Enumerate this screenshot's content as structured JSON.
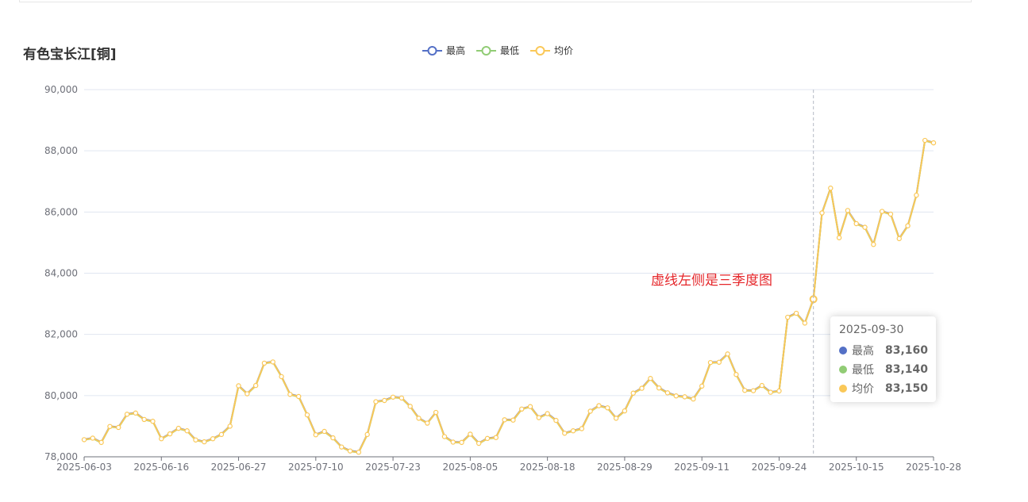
{
  "title": "有色宝长江[铜]",
  "annotation": "虚线左侧是三季度图",
  "legend": [
    {
      "name": "最高",
      "color": "#5470c6"
    },
    {
      "name": "最低",
      "color": "#91cc75"
    },
    {
      "name": "均价",
      "color": "#fac858"
    }
  ],
  "tooltip": {
    "date": "2025-09-30",
    "rows": [
      {
        "name": "最高",
        "value": "83,160",
        "color": "#5470c6"
      },
      {
        "name": "最低",
        "value": "83,140",
        "color": "#91cc75"
      },
      {
        "name": "均价",
        "value": "83,150",
        "color": "#fac858"
      }
    ]
  },
  "chart_data": {
    "type": "line",
    "title": "有色宝长江[铜]",
    "ylim": [
      78000,
      90000
    ],
    "y_ticks": [
      "78,000",
      "80,000",
      "82,000",
      "84,000",
      "86,000",
      "88,000",
      "90,000"
    ],
    "x_ticks": [
      "2025-06-03",
      "2025-06-16",
      "2025-06-27",
      "2025-07-10",
      "2025-07-23",
      "2025-08-05",
      "2025-08-18",
      "2025-08-29",
      "2025-09-11",
      "2025-09-24",
      "2025-10-15",
      "2025-10-28"
    ],
    "grid": true,
    "legend_position": "top-center",
    "highlight_date": "2025-09-30",
    "dates": [
      "2025-06-03",
      "2025-06-04",
      "2025-06-05",
      "2025-06-06",
      "2025-06-09",
      "2025-06-10",
      "2025-06-11",
      "2025-06-12",
      "2025-06-13",
      "2025-06-16",
      "2025-06-17",
      "2025-06-18",
      "2025-06-19",
      "2025-06-20",
      "2025-06-23",
      "2025-06-24",
      "2025-06-25",
      "2025-06-26",
      "2025-06-27",
      "2025-06-30",
      "2025-07-01",
      "2025-07-02",
      "2025-07-03",
      "2025-07-04",
      "2025-07-07",
      "2025-07-08",
      "2025-07-09",
      "2025-07-10",
      "2025-07-11",
      "2025-07-14",
      "2025-07-15",
      "2025-07-16",
      "2025-07-17",
      "2025-07-18",
      "2025-07-21",
      "2025-07-22",
      "2025-07-23",
      "2025-07-24",
      "2025-07-25",
      "2025-07-28",
      "2025-07-29",
      "2025-07-30",
      "2025-07-31",
      "2025-08-01",
      "2025-08-04",
      "2025-08-05",
      "2025-08-06",
      "2025-08-07",
      "2025-08-08",
      "2025-08-11",
      "2025-08-12",
      "2025-08-13",
      "2025-08-14",
      "2025-08-15",
      "2025-08-18",
      "2025-08-19",
      "2025-08-20",
      "2025-08-21",
      "2025-08-22",
      "2025-08-25",
      "2025-08-26",
      "2025-08-27",
      "2025-08-28",
      "2025-08-29",
      "2025-09-01",
      "2025-09-02",
      "2025-09-03",
      "2025-09-04",
      "2025-09-05",
      "2025-09-08",
      "2025-09-09",
      "2025-09-10",
      "2025-09-11",
      "2025-09-12",
      "2025-09-15",
      "2025-09-16",
      "2025-09-17",
      "2025-09-18",
      "2025-09-19",
      "2025-09-22",
      "2025-09-23",
      "2025-09-24",
      "2025-09-25",
      "2025-09-26",
      "2025-09-29",
      "2025-09-30",
      "2025-10-09",
      "2025-10-10",
      "2025-10-13",
      "2025-10-14",
      "2025-10-15",
      "2025-10-16",
      "2025-10-17",
      "2025-10-20",
      "2025-10-21",
      "2025-10-22",
      "2025-10-23",
      "2025-10-24",
      "2025-10-27",
      "2025-10-28"
    ],
    "series": [
      {
        "name": "最高",
        "values": [
          78570,
          78620,
          78480,
          79000,
          78970,
          79400,
          79440,
          79230,
          79170,
          78600,
          78760,
          78940,
          78860,
          78560,
          78500,
          78600,
          78740,
          79010,
          80330,
          80070,
          80340,
          81070,
          81110,
          80630,
          80050,
          79980,
          79380,
          78730,
          78840,
          78630,
          78330,
          78200,
          78160,
          78740,
          79810,
          79850,
          79960,
          79930,
          79660,
          79270,
          79110,
          79460,
          78670,
          78490,
          78480,
          78750,
          78450,
          78610,
          78640,
          79220,
          79210,
          79570,
          79650,
          79290,
          79420,
          79200,
          78780,
          78860,
          78930,
          79500,
          79680,
          79610,
          79270,
          79510,
          80090,
          80250,
          80570,
          80260,
          80100,
          80000,
          79970,
          79900,
          80320,
          81090,
          81100,
          81370,
          80700,
          80180,
          80170,
          80340,
          80120,
          80160,
          82570,
          82700,
          82380,
          83160,
          85980,
          86790,
          85170,
          86060,
          85630,
          85510,
          84950,
          86030,
          85940,
          85140,
          85560,
          86560,
          88350,
          88270
        ]
      },
      {
        "name": "最低",
        "values": [
          78550,
          78600,
          78460,
          78980,
          78950,
          79380,
          79420,
          79210,
          79150,
          78580,
          78740,
          78920,
          78840,
          78540,
          78480,
          78580,
          78720,
          78990,
          80310,
          80050,
          80320,
          81050,
          81090,
          80610,
          80030,
          79960,
          79360,
          78710,
          78820,
          78610,
          78310,
          78180,
          78140,
          78720,
          79790,
          79830,
          79940,
          79910,
          79640,
          79250,
          79090,
          79440,
          78650,
          78470,
          78460,
          78730,
          78430,
          78590,
          78620,
          79200,
          79190,
          79550,
          79630,
          79270,
          79400,
          79180,
          78760,
          78840,
          78910,
          79480,
          79660,
          79590,
          79250,
          79490,
          80070,
          80230,
          80550,
          80240,
          80080,
          79980,
          79950,
          79880,
          80300,
          81070,
          81080,
          81350,
          80680,
          80160,
          80150,
          80320,
          80100,
          80140,
          82550,
          82680,
          82360,
          83140,
          85960,
          86770,
          85150,
          86040,
          85610,
          85490,
          84930,
          86010,
          85920,
          85120,
          85540,
          86540,
          88330,
          88250
        ]
      },
      {
        "name": "均价",
        "values": [
          78560,
          78610,
          78470,
          78990,
          78960,
          79390,
          79430,
          79220,
          79160,
          78590,
          78750,
          78930,
          78850,
          78550,
          78490,
          78590,
          78730,
          79000,
          80320,
          80060,
          80330,
          81060,
          81100,
          80620,
          80040,
          79970,
          79370,
          78720,
          78830,
          78620,
          78320,
          78190,
          78150,
          78730,
          79800,
          79840,
          79950,
          79920,
          79650,
          79260,
          79100,
          79450,
          78660,
          78480,
          78470,
          78740,
          78440,
          78600,
          78630,
          79210,
          79200,
          79560,
          79640,
          79280,
          79410,
          79190,
          78770,
          78850,
          78920,
          79490,
          79670,
          79600,
          79260,
          79500,
          80080,
          80240,
          80560,
          80250,
          80090,
          79990,
          79960,
          79890,
          80310,
          81080,
          81090,
          81360,
          80690,
          80170,
          80160,
          80330,
          80110,
          80150,
          82560,
          82690,
          82370,
          83150,
          85970,
          86780,
          85160,
          86050,
          85620,
          85500,
          84940,
          86020,
          85930,
          85130,
          85550,
          86550,
          88340,
          88260
        ]
      }
    ]
  }
}
